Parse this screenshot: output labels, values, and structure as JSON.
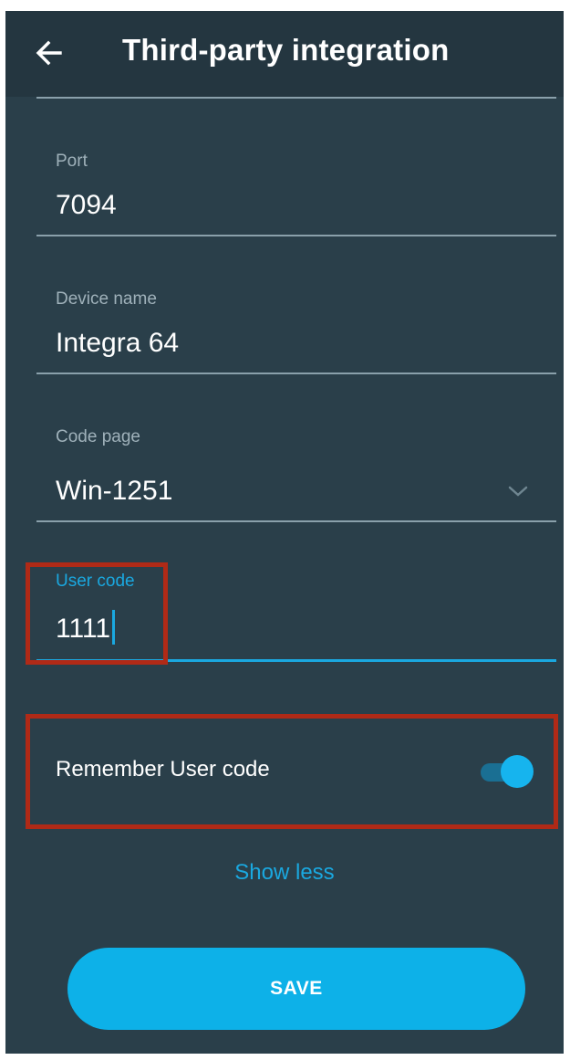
{
  "header": {
    "title": "Third-party integration",
    "back_icon": "arrow-left-icon"
  },
  "form": {
    "port": {
      "label": "Port",
      "value": "7094"
    },
    "device_name": {
      "label": "Device name",
      "value": "Integra 64"
    },
    "code_page": {
      "label": "Code page",
      "value": "Win-1251",
      "dropdown_icon": "chevron-down-icon"
    },
    "user_code": {
      "label": "User code",
      "value": "1111"
    }
  },
  "remember": {
    "label": "Remember User code",
    "enabled": true
  },
  "show_less_label": "Show less",
  "save_label": "SAVE",
  "colors": {
    "background": "#2a3f4a",
    "appbar": "#243640",
    "accent": "#1aa8e0",
    "highlight": "#b02a17"
  }
}
